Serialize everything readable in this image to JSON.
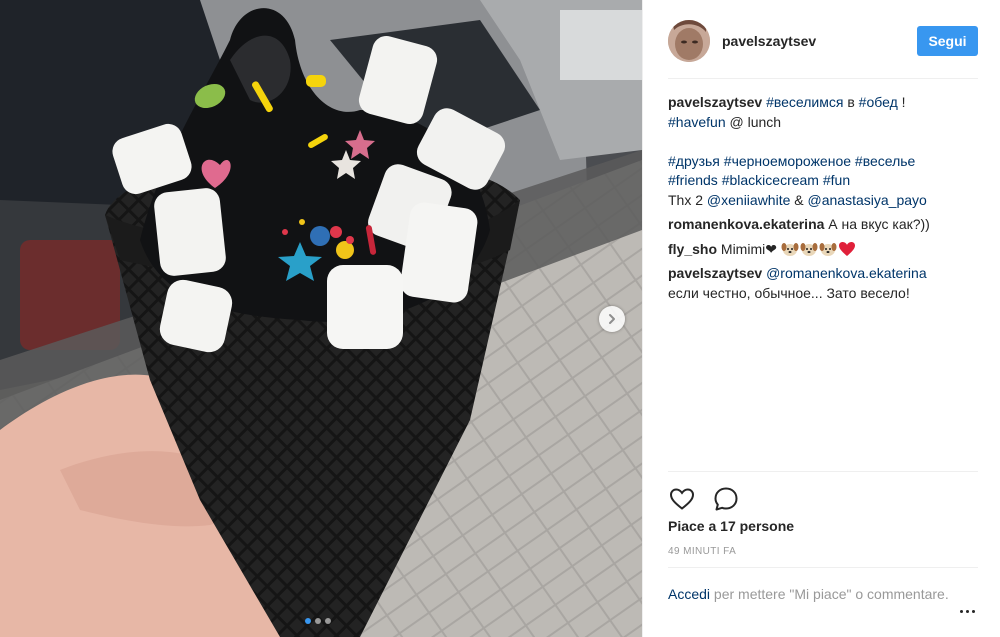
{
  "post": {
    "username": "pavelszaytsev",
    "follow_label": "Segui"
  },
  "comments": [
    {
      "user": "pavelszaytsev",
      "line1": {
        "tag1": "#веселимся",
        "t1": " в ",
        "tag2": "#обед",
        "t2": " !"
      },
      "line2": {
        "tag3": "#havefun",
        "t3": " @ lunch"
      },
      "line4": {
        "tag4": "#друзья",
        "tag5": "#черноемороженое",
        "tag6": "#веселье"
      },
      "line5": {
        "tag7": "#friends",
        "tag8": "#blackicecream",
        "tag9": "#fun"
      },
      "line6": {
        "t4": "Thx 2 ",
        "tag10": "@xeniiawhite",
        "t5": " & ",
        "tag11": "@anastasiya_payo"
      }
    },
    {
      "user": "romanenkova.ekaterina",
      "text": " А на вкус как?))"
    },
    {
      "user": "fly_sho",
      "text": " Mimimi❤"
    },
    {
      "user": "pavelszaytsev",
      "mention": "@romanenkova.ekaterina",
      "text": "если честно, обычное... Зато весело!"
    }
  ],
  "likes": "Piace a 17 persone",
  "time": "49 MINUTI FA",
  "login": {
    "link": "Accedi",
    "text": " per mettere \"Mi piace\" o commentare."
  },
  "icons": {
    "like": "heart-icon",
    "comment": "comment-icon",
    "next": "chevron-right-icon",
    "more": "more-options-icon"
  },
  "carousel": {
    "count": 3,
    "active": 1
  },
  "colors": {
    "accent": "#3897f0",
    "link": "#003569",
    "muted": "#999999"
  }
}
